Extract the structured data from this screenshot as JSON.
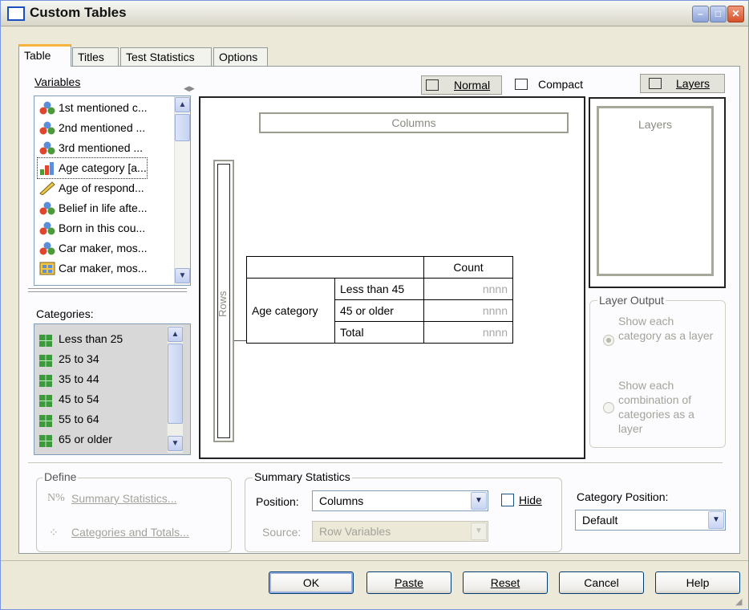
{
  "window": {
    "title": "Custom Tables"
  },
  "tabs": [
    {
      "label": "Table",
      "active": true
    },
    {
      "label": "Titles"
    },
    {
      "label": "Test Statistics"
    },
    {
      "label": "Options"
    }
  ],
  "variables": {
    "label": "Variables",
    "items": [
      {
        "label": "1st mentioned c...",
        "icon": "nominal-icon"
      },
      {
        "label": "2nd mentioned ...",
        "icon": "nominal-icon"
      },
      {
        "label": "3rd mentioned ...",
        "icon": "nominal-icon"
      },
      {
        "label": "Age category [a...",
        "icon": "ordinal-icon"
      },
      {
        "label": "Age of respond...",
        "icon": "scale-ruler-icon"
      },
      {
        "label": "Belief in life afte...",
        "icon": "nominal-icon"
      },
      {
        "label": "Born in this cou...",
        "icon": "nominal-icon"
      },
      {
        "label": "Car maker, mos...",
        "icon": "nominal-icon"
      },
      {
        "label": "Car maker, mos...",
        "icon": "multiple-response-icon"
      }
    ]
  },
  "categories": {
    "label": "Categories:",
    "items": [
      "Less than 25",
      "25 to 34",
      "35 to 44",
      "45 to 54",
      "55 to 64",
      "65 or older"
    ]
  },
  "view": {
    "normal_label": "Normal",
    "compact_label": "Compact",
    "layers_label": "Layers"
  },
  "canvas": {
    "columns_label": "Columns",
    "rows_label": "Rows",
    "layers_label": "Layers",
    "table": {
      "stat_header": "Count",
      "row_variable": "Age category",
      "rows": [
        {
          "category": "Less than 45",
          "value": "nnnn"
        },
        {
          "category": "45 or older",
          "value": "nnnn"
        },
        {
          "category": "Total",
          "value": "nnnn"
        }
      ]
    }
  },
  "layer_output": {
    "title": "Layer Output",
    "option1": "Show each category as a layer",
    "option2": "Show each combination of categories as a layer"
  },
  "define": {
    "title": "Define",
    "summary_statistics": "Summary Statistics...",
    "categories_totals": "Categories and Totals..."
  },
  "summary_statistics": {
    "title": "Summary Statistics",
    "position_label": "Position:",
    "position_value": "Columns",
    "hide_label": "Hide",
    "source_label": "Source:",
    "source_value": "Row Variables"
  },
  "category_position": {
    "label": "Category Position:",
    "value": "Default"
  },
  "buttons": {
    "ok": "OK",
    "paste": "Paste",
    "reset": "Reset",
    "cancel": "Cancel",
    "help": "Help"
  }
}
